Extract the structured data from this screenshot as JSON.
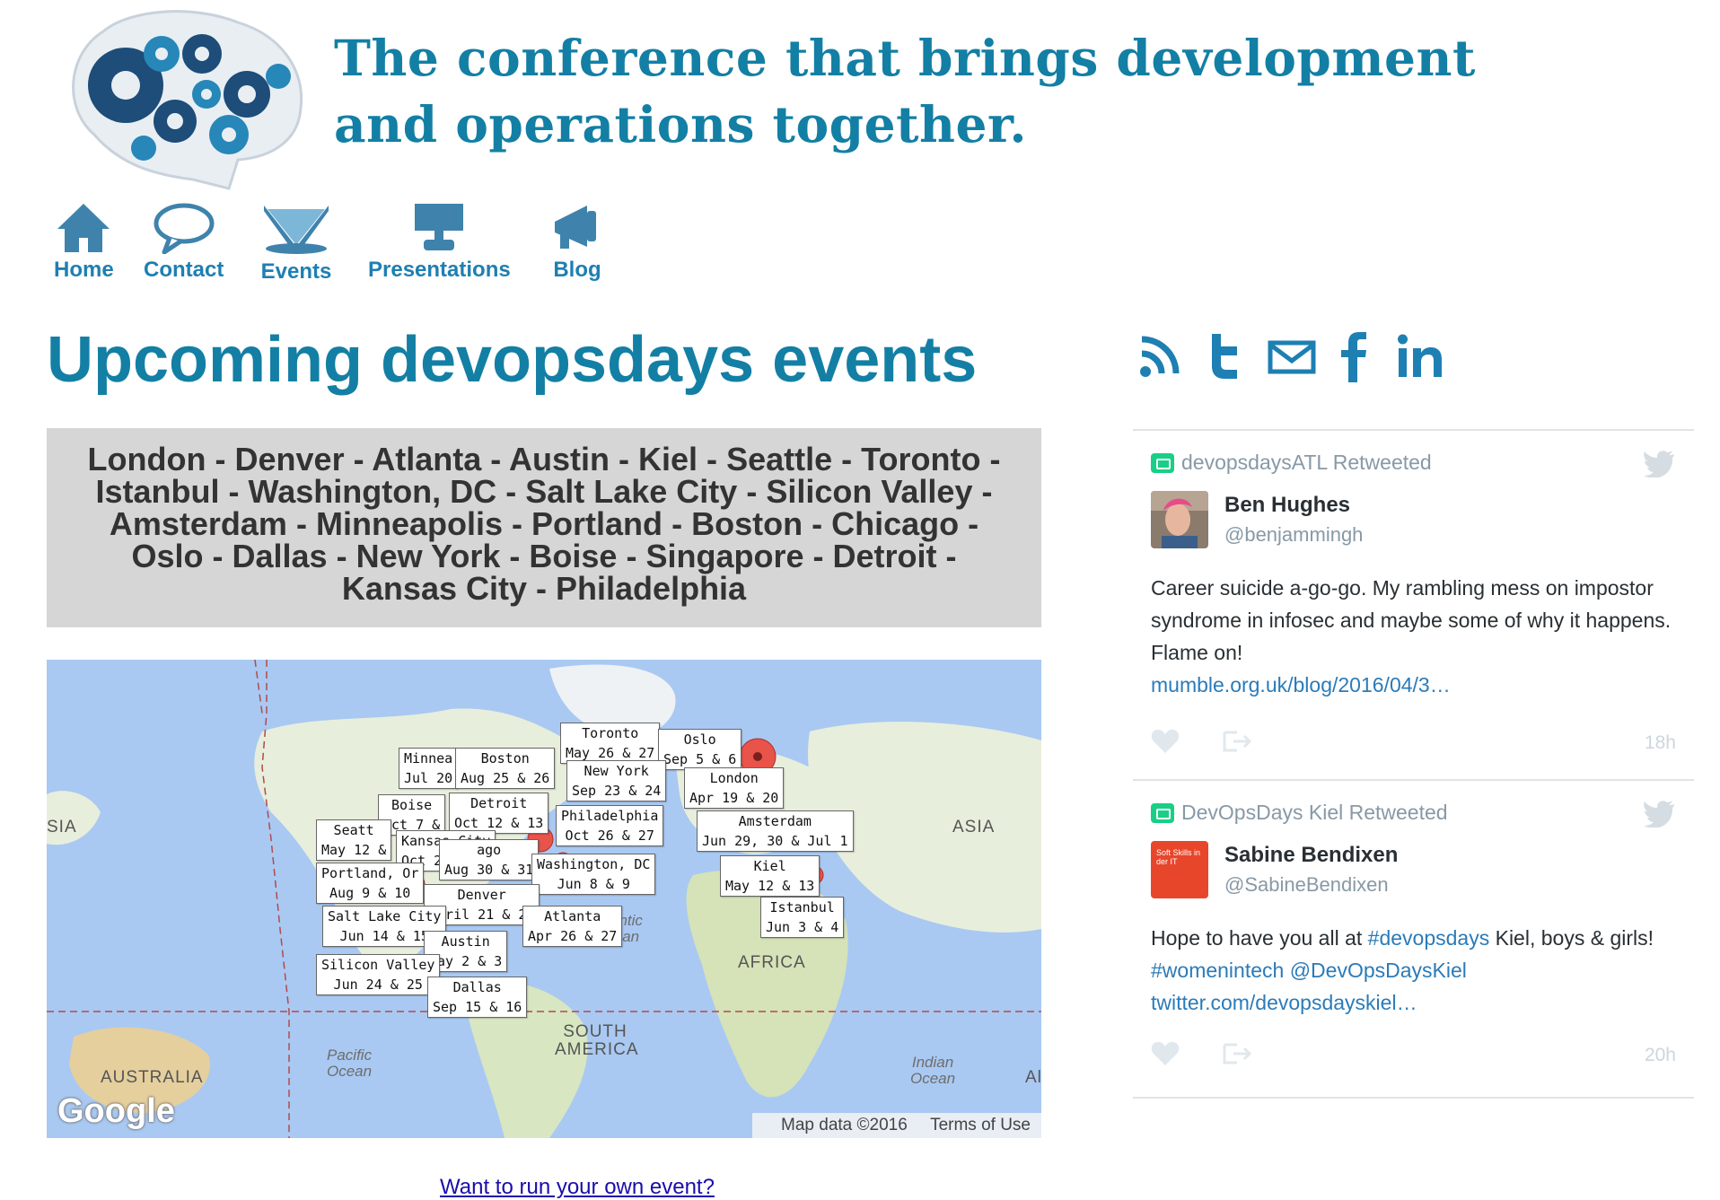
{
  "header": {
    "tagline_line1": "The conference that brings development",
    "tagline_line2": "and operations together.",
    "brand_color": "#137fa4"
  },
  "nav": [
    {
      "label": "Home",
      "icon": "house-icon"
    },
    {
      "label": "Contact",
      "icon": "speech-bubble-icon"
    },
    {
      "label": "Events",
      "icon": "spotlight-stage-icon"
    },
    {
      "label": "Presentations",
      "icon": "projector-screen-icon"
    },
    {
      "label": "Blog",
      "icon": "megaphone-icon"
    }
  ],
  "main": {
    "title": "Upcoming devopsdays events",
    "cities": [
      "London",
      "Denver",
      "Atlanta",
      "Austin",
      "Kiel",
      "Seattle",
      "Toronto",
      "Istanbul",
      "Washington, DC",
      "Salt Lake City",
      "Silicon Valley",
      "Amsterdam",
      "Minneapolis",
      "Portland",
      "Boston",
      "Chicago",
      "Oslo",
      "Dallas",
      "New York",
      "Boise",
      "Singapore",
      "Detroit",
      "Kansas City",
      "Philadelphia"
    ],
    "separator": "-",
    "run_event_link": "Want to run your own event?"
  },
  "map": {
    "markers": [
      {
        "city": "Toronto",
        "dates": "May 26 & 27"
      },
      {
        "city": "Oslo",
        "dates": "Sep 5 & 6"
      },
      {
        "city": "Minnea",
        "dates": "Jul 20"
      },
      {
        "city": "Boston",
        "dates": "Aug 25 & 26"
      },
      {
        "city": "New York",
        "dates": "Sep 23 & 24"
      },
      {
        "city": "London",
        "dates": "Apr 19 & 20"
      },
      {
        "city": "Boise",
        "dates": "Oct 7 &"
      },
      {
        "city": "Detroit",
        "dates": "Oct 12 & 13"
      },
      {
        "city": "Philadelphia",
        "dates": "Oct 26 & 27"
      },
      {
        "city": "Amsterdam",
        "dates": "Jun 29, 30 & Jul 1"
      },
      {
        "city": "Seatt",
        "dates": "May 12 &"
      },
      {
        "city": "Kansas City",
        "dates": "Oct 20 & 21"
      },
      {
        "city": "ago",
        "dates": "Aug 30 & 31"
      },
      {
        "city": "Washington, DC",
        "dates": "Jun 8 & 9"
      },
      {
        "city": "Kiel",
        "dates": "May 12 & 13"
      },
      {
        "city": "Portland, Or",
        "dates": "Aug 9 & 10"
      },
      {
        "city": "Denver",
        "dates": "April 21 & 22"
      },
      {
        "city": "Salt Lake City",
        "dates": "Jun 14 & 15"
      },
      {
        "city": "Atlanta",
        "dates": "Apr 26 & 27"
      },
      {
        "city": "Istanbul",
        "dates": "Jun 3 & 4"
      },
      {
        "city": "Austin",
        "dates": "May 2 & 3"
      },
      {
        "city": "Silicon Valley",
        "dates": "Jun 24 & 25"
      },
      {
        "city": "Dallas",
        "dates": "Sep 15 & 16"
      }
    ],
    "labels": {
      "asia_left": "SIA",
      "asia": "ASIA",
      "africa": "AFRICA",
      "south_america": "SOUTH AMERICA",
      "australia": "AUSTRALIA",
      "atlantic": "antic\nean",
      "pacific": "Pacific\nOcean",
      "indian": "Indian\nOcean",
      "au_right": "Al"
    },
    "google_logo": "Google",
    "map_data": "Map data ©2016",
    "terms": "Terms of Use",
    "land_color": "#e8eedc",
    "water_color": "#a9c9f2",
    "marker_color": "#e8534a"
  },
  "social": [
    "rss-icon",
    "twitter-icon",
    "email-icon",
    "facebook-icon",
    "linkedin-icon"
  ],
  "tweets": [
    {
      "retweeted_by": "devopsdaysATL Retweeted",
      "name": "Ben Hughes",
      "handle": "@benjammingh",
      "text": "Career suicide a-go-go. My rambling mess on impostor syndrome in infosec and maybe some of why it happens. Flame on!",
      "link": "mumble.org.uk/blog/2016/04/3…",
      "time": "18h"
    },
    {
      "retweeted_by": "DevOpsDays Kiel Retweeted",
      "name": "Sabine Bendixen",
      "handle": "@SabineBendixen",
      "avatar_text": "Soft Skills in der IT",
      "text_pre": "Hope to have you all at ",
      "hashtag1": "#devopsdays",
      "text_mid": " Kiel, boys & girls! ",
      "hashtag2": "#womenintech",
      "mention": "@DevOpsDaysKiel",
      "link": "twitter.com/devopsdayskiel…",
      "time": "20h"
    }
  ]
}
